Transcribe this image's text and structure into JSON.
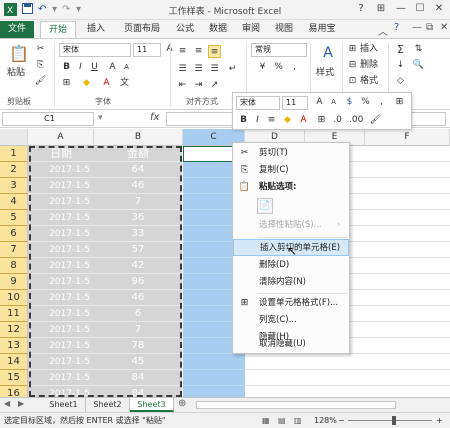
{
  "window": {
    "title": "工作样表 - Microsoft Excel",
    "controls": [
      "?",
      "⊞",
      "—",
      "☐",
      "✕"
    ]
  },
  "tabs": [
    "文件",
    "开始",
    "插入",
    "页面布局",
    "公式",
    "数据",
    "审阅",
    "视图",
    "易用宝"
  ],
  "ribbon": {
    "paste_label": "粘贴",
    "font_name": "宋体",
    "font_size": "11",
    "number_format": "常规",
    "styles_label": "样式",
    "insert_label": "插入",
    "delete_label": "删除",
    "format_label": "格式",
    "groups": [
      "剪贴板",
      "字体",
      "对齐方式"
    ]
  },
  "formula_bar": {
    "name_box": "C1",
    "fx": "fx"
  },
  "mini_toolbar": {
    "font_name": "宋体",
    "font_size": "11"
  },
  "columns": [
    "A",
    "B",
    "C",
    "D",
    "E",
    "F"
  ],
  "rows": [
    {
      "num": "1",
      "a": "日期",
      "b": "金额"
    },
    {
      "num": "2",
      "a": "2017-1-5",
      "b": "64"
    },
    {
      "num": "3",
      "a": "2017-1-5",
      "b": "46"
    },
    {
      "num": "4",
      "a": "2017-1-5",
      "b": "7"
    },
    {
      "num": "5",
      "a": "2017-1-5",
      "b": "36"
    },
    {
      "num": "6",
      "a": "2017-1-5",
      "b": "33"
    },
    {
      "num": "7",
      "a": "2017-1-5",
      "b": "57"
    },
    {
      "num": "8",
      "a": "2017-1-5",
      "b": "42"
    },
    {
      "num": "9",
      "a": "2017-1-5",
      "b": "96"
    },
    {
      "num": "10",
      "a": "2017-1-5",
      "b": "46"
    },
    {
      "num": "11",
      "a": "2017-1-5",
      "b": "6"
    },
    {
      "num": "12",
      "a": "2017-1-5",
      "b": "7"
    },
    {
      "num": "13",
      "a": "2017-1-5",
      "b": "78"
    },
    {
      "num": "14",
      "a": "2017-1-5",
      "b": "45"
    },
    {
      "num": "15",
      "a": "2017-1-5",
      "b": "84"
    },
    {
      "num": "16",
      "a": "2017-1-5",
      "b": "84"
    }
  ],
  "context_menu": {
    "cut": "剪切(T)",
    "copy": "复制(C)",
    "paste_options": "粘贴选项:",
    "paste_special": "选择性粘贴(S)...",
    "insert_cut_cells": "插入剪切的单元格(E)",
    "delete": "删除(D)",
    "clear_contents": "清除内容(N)",
    "format_cells": "设置单元格格式(F)...",
    "column_width": "列宽(C)...",
    "hide": "隐藏(H)",
    "unhide": "取消隐藏(U)"
  },
  "sheets": [
    "Sheet1",
    "Sheet2",
    "Sheet3"
  ],
  "status": {
    "message": "选定目标区域，然后按 ENTER 或选择 \"粘贴\"",
    "zoom": "128%"
  },
  "colors": {
    "accent": "#1f7244",
    "selection": "#a7cdf0",
    "row_header": "#f9e29c"
  }
}
